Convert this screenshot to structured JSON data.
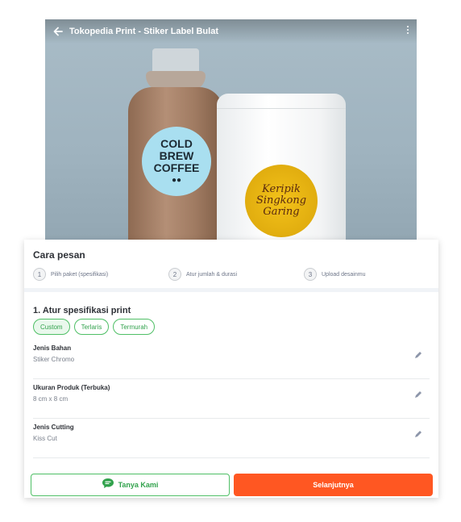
{
  "header": {
    "title": "Tokopedia Print - Stiker Label Bulat",
    "back_icon": "arrow-left-icon",
    "menu_icon": "kebab-menu-icon"
  },
  "hero": {
    "cold_sticker_lines": [
      "COLD",
      "BREW",
      "COFFEE"
    ],
    "keripik_sticker_lines": [
      "Keripik",
      "Singkong",
      "Garing"
    ]
  },
  "order": {
    "title": "Cara pesan",
    "steps": [
      {
        "num": "1",
        "label": "Pilih paket (spesifikasi)"
      },
      {
        "num": "2",
        "label": "Atur jumlah & durasi"
      },
      {
        "num": "3",
        "label": "Upload desainmu"
      }
    ]
  },
  "spec": {
    "title": "1. Atur spesifikasi print",
    "chips": [
      "Custom",
      "Terlaris",
      "Termurah"
    ],
    "rows": [
      {
        "title": "Jenis Bahan",
        "value": "Stiker Chromo"
      },
      {
        "title": "Ukuran Produk (Terbuka)",
        "value": "8 cm x 8 cm"
      },
      {
        "title": "Jenis Cutting",
        "value": "Kiss Cut"
      }
    ]
  },
  "actions": {
    "ask_label": "Tanya Kami",
    "next_label": "Selanjutnya"
  },
  "colors": {
    "green": "#31a24c",
    "orange": "#ff5722"
  }
}
